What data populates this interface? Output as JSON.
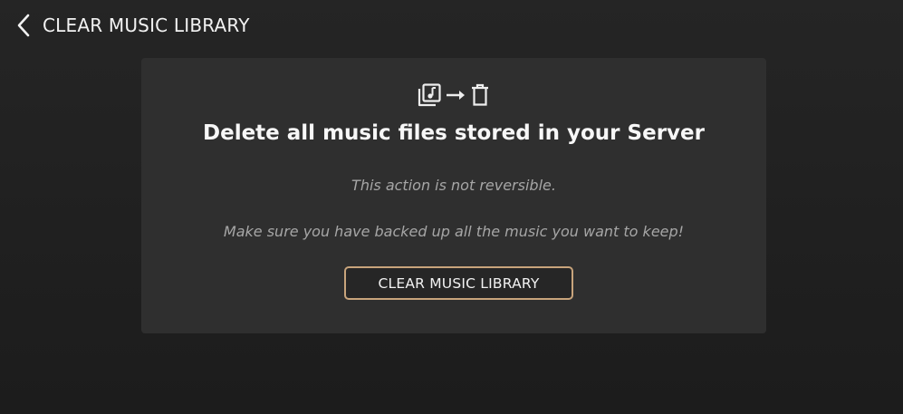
{
  "header": {
    "back_icon": "chevron-left-icon",
    "title": "CLEAR MUSIC LIBRARY"
  },
  "card": {
    "icons": [
      "music-library-icon",
      "arrow-right-icon",
      "trash-icon"
    ],
    "heading": "Delete all music files stored in your Server",
    "message_1": "This action is not reversible.",
    "message_2": "Make sure you have backed up all the music you want to keep!",
    "button_label": "CLEAR MUSIC LIBRARY"
  },
  "colors": {
    "background": "#222222",
    "card": "#2f2f2f",
    "button_border": "#c8a47c",
    "muted_text": "#a6a6a6"
  }
}
